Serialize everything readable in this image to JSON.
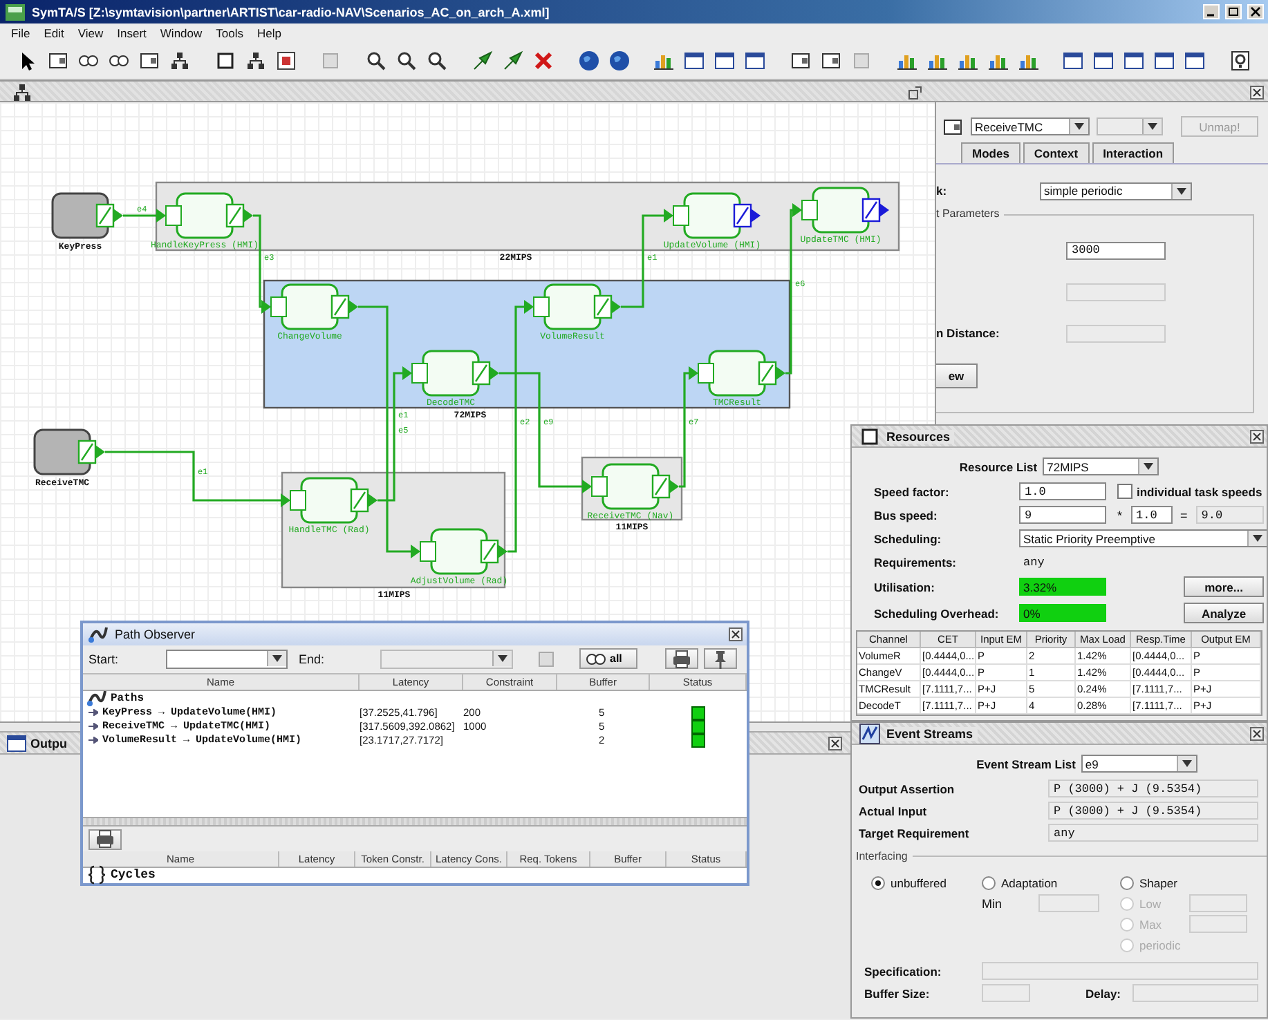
{
  "window": {
    "title": "SymTA/S [Z:\\symtavision\\partner\\ARTIST\\car-radio-NAV\\Scenarios_AC_on_arch_A.xml]"
  },
  "menu": [
    "File",
    "Edit",
    "View",
    "Insert",
    "Window",
    "Tools",
    "Help"
  ],
  "diagram": {
    "sources": [
      {
        "label": "KeyPress"
      },
      {
        "label": "ReceiveTMC"
      }
    ],
    "resources": [
      {
        "label": "22MIPS",
        "selected": false,
        "tasks": [
          {
            "label": "HandleKeyPress (HMI)",
            "kind": "task"
          },
          {
            "label": "UpdateVolume (HMI)",
            "kind": "sink"
          },
          {
            "label": "UpdateTMC (HMI)",
            "kind": "sink"
          }
        ]
      },
      {
        "label": "72MIPS",
        "selected": true,
        "tasks": [
          {
            "label": "ChangeVolume",
            "kind": "task"
          },
          {
            "label": "VolumeResult",
            "kind": "task"
          },
          {
            "label": "DecodeTMC",
            "kind": "task"
          },
          {
            "label": "TMCResult",
            "kind": "task"
          }
        ]
      },
      {
        "label": "11MIPS",
        "selected": false,
        "tasks": [
          {
            "label": "HandleTMC (Rad)",
            "kind": "task"
          },
          {
            "label": "AdjustVolume (Rad)",
            "kind": "task"
          }
        ]
      },
      {
        "label": "11MIPS",
        "selected": false,
        "tasks": [
          {
            "label": "ReceiveTMC (Nav)",
            "kind": "task"
          }
        ]
      }
    ],
    "edges": [
      {
        "label": "e4"
      },
      {
        "label": "e3"
      },
      {
        "label": "e1"
      },
      {
        "label": "e5"
      },
      {
        "label": "e2"
      },
      {
        "label": "e1"
      },
      {
        "label": "e9"
      },
      {
        "label": "e7"
      },
      {
        "label": "e6"
      },
      {
        "label": "e1"
      }
    ]
  },
  "properties": {
    "task_select": "ReceiveTMC",
    "unmap_button": "Unmap!",
    "tabs": [
      {
        "label": "Modes",
        "selected": false
      },
      {
        "label": "Context",
        "selected": false
      },
      {
        "label": "Interaction",
        "selected": false
      }
    ],
    "model_label": "k:",
    "model_value": "simple periodic",
    "group_title": "t Parameters",
    "period_value": "3000",
    "distance_label": "n Distance:",
    "view_button": "ew"
  },
  "resources": {
    "title": "Resources",
    "list_label": "Resource List",
    "list_value": "72MIPS",
    "speed_factor": {
      "label": "Speed factor:",
      "value": "1.0"
    },
    "individual": {
      "label": "individual task speeds",
      "checked": false
    },
    "bus_speed": {
      "label": "Bus speed:",
      "values": [
        "9",
        "1.0",
        "9.0"
      ],
      "operators": [
        "*",
        "="
      ]
    },
    "scheduling": {
      "label": "Scheduling:",
      "value": "Static Priority Preemptive"
    },
    "requirements": {
      "label": "Requirements:",
      "value": "any"
    },
    "utilisation": {
      "label": "Utilisation:",
      "value": "3.32%",
      "ok": true
    },
    "overhead": {
      "label": "Scheduling Overhead:",
      "value": "0%",
      "ok": true
    },
    "more_button": "more...",
    "analyze_button": "Analyze",
    "table": {
      "columns": [
        "Channel",
        "CET",
        "Input EM",
        "Priority",
        "Max Load",
        "Resp.Time",
        "Output EM"
      ],
      "rows": [
        [
          "VolumeR",
          "[0.4444,0...",
          "P",
          "2",
          "1.42%",
          "[0.4444,0...",
          "P"
        ],
        [
          "ChangeV",
          "[0.4444,0...",
          "P",
          "1",
          "1.42%",
          "[0.4444,0...",
          "P"
        ],
        [
          "TMCResult",
          "[7.1111,7...",
          "P+J",
          "5",
          "0.24%",
          "[7.1111,7...",
          "P+J"
        ],
        [
          "DecodeT",
          "[7.1111,7...",
          "P+J",
          "4",
          "0.28%",
          "[7.1111,7...",
          "P+J"
        ]
      ]
    }
  },
  "event_streams": {
    "title": "Event Streams",
    "list_label": "Event Stream List",
    "list_value": "e9",
    "output_assertion": {
      "label": "Output Assertion",
      "value": "P (3000) + J (9.5354)"
    },
    "actual_input": {
      "label": "Actual Input",
      "value": "P (3000) + J (9.5354)"
    },
    "target": {
      "label": "Target Requirement",
      "value": "any"
    },
    "interfacing_title": "Interfacing",
    "options": [
      {
        "label": "unbuffered",
        "selected": true,
        "disabled": false
      },
      {
        "label": "Adaptation",
        "selected": false,
        "disabled": false
      },
      {
        "label": "Shaper",
        "selected": false,
        "disabled": false
      },
      {
        "label": "Low",
        "selected": false,
        "disabled": true
      },
      {
        "label": "Max",
        "selected": false,
        "disabled": true
      },
      {
        "label": "periodic",
        "selected": false,
        "disabled": true
      }
    ],
    "min_label": "Min",
    "specification_label": "Specification:",
    "buffer_label": "Buffer Size:",
    "delay_label": "Delay:"
  },
  "output_panel": {
    "title": "Outpu"
  },
  "path_observer": {
    "title": "Path Observer",
    "start_label": "Start:",
    "end_label": "End:",
    "all_button": "all",
    "columns": [
      "Name",
      "Latency",
      "Constraint",
      "Buffer",
      "Status"
    ],
    "root": "Paths",
    "paths": [
      {
        "name": "KeyPress → UpdateVolume(HMI)",
        "latency": "[37.2525,41.796]",
        "constraint": "200",
        "buffer": "5",
        "ok": true
      },
      {
        "name": "ReceiveTMC → UpdateTMC(HMI)",
        "latency": "[317.5609,392.0862]",
        "constraint": "1000",
        "buffer": "5",
        "ok": true
      },
      {
        "name": "VolumeResult → UpdateVolume(HMI)",
        "latency": "[23.1717,27.7172]",
        "buffer": "2",
        "ok": true
      }
    ],
    "cycles_columns": [
      "Name",
      "Latency",
      "Token Constr.",
      "Latency Cons.",
      "Req. Tokens",
      "Buffer",
      "Status"
    ],
    "cycles_root": "Cycles"
  }
}
